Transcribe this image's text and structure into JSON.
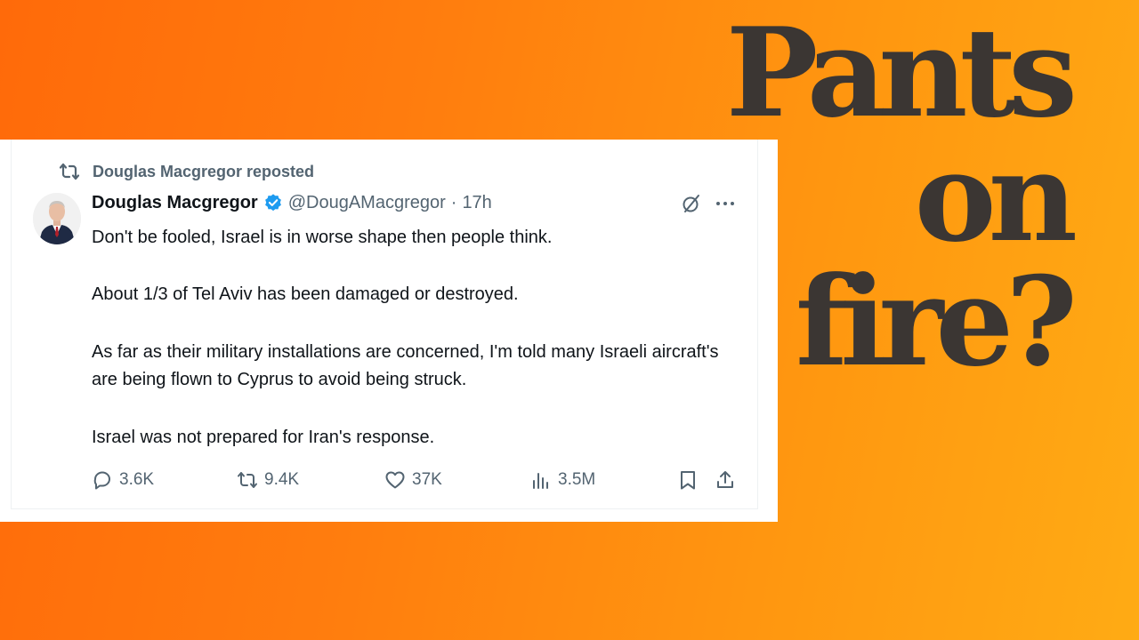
{
  "headline": {
    "line1": "Pants",
    "line2": "on",
    "line3": "fire?"
  },
  "tweet": {
    "repost_label": "Douglas Macgregor reposted",
    "display_name": "Douglas Macgregor",
    "handle": "@DougAMacgregor",
    "separator": "·",
    "time": "17h",
    "paragraphs": [
      "Don't be fooled, Israel is in worse shape then people think.",
      "About 1/3 of Tel Aviv has been damaged or destroyed.",
      "As far as their military installations are concerned, I'm told many Israeli aircraft's are being flown to Cyprus to avoid being struck.",
      "Israel was not prepared for Iran's response."
    ],
    "stats": {
      "replies": "3.6K",
      "reposts": "9.4K",
      "likes": "37K",
      "views": "3.5M"
    },
    "icons": {
      "repost_indicator": "repost-icon",
      "verified": "verified-badge-icon",
      "grok": "grok-icon",
      "more": "more-icon",
      "reply": "reply-icon",
      "repost": "repost-icon",
      "like": "heart-icon",
      "views": "views-icon",
      "bookmark": "bookmark-icon",
      "share": "share-icon"
    }
  },
  "colors": {
    "background_start": "#ff6a0a",
    "background_end": "#ffab14",
    "headline_text": "#3b3633",
    "secondary_text": "#536471",
    "primary_text": "#0f1419",
    "verified_blue": "#1d9bf0"
  }
}
